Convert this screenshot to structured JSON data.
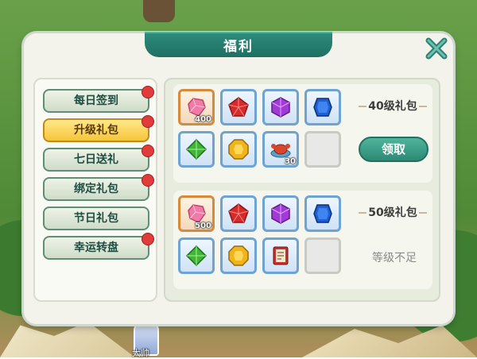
{
  "header": {
    "title": "福利"
  },
  "sidebar": {
    "items": [
      {
        "label": "每日签到",
        "active": false,
        "badge": true
      },
      {
        "label": "升级礼包",
        "active": true,
        "badge": true
      },
      {
        "label": "七日送礼",
        "active": false,
        "badge": true
      },
      {
        "label": "绑定礼包",
        "active": false,
        "badge": true
      },
      {
        "label": "节日礼包",
        "active": false,
        "badge": false
      },
      {
        "label": "幸运转盘",
        "active": false,
        "badge": true
      }
    ]
  },
  "packs": [
    {
      "label": "40级礼包",
      "action": "领取",
      "items": [
        {
          "icon": "pink-gem-icon",
          "qty": "400"
        },
        {
          "icon": "red-gem-icon",
          "qty": ""
        },
        {
          "icon": "purple-gem-icon",
          "qty": ""
        },
        {
          "icon": "blue-gem-icon",
          "qty": ""
        },
        {
          "icon": "green-gem-icon",
          "qty": ""
        },
        {
          "icon": "yellow-gem-icon",
          "qty": ""
        },
        {
          "icon": "crab-food-icon",
          "qty": "30"
        },
        {
          "icon": "",
          "qty": ""
        }
      ]
    },
    {
      "label": "50级礼包",
      "status": "等级不足",
      "items": [
        {
          "icon": "pink-gem-icon",
          "qty": "500"
        },
        {
          "icon": "red-gem-icon",
          "qty": ""
        },
        {
          "icon": "purple-gem-icon",
          "qty": ""
        },
        {
          "icon": "blue-gem-icon",
          "qty": ""
        },
        {
          "icon": "green-gem-icon",
          "qty": ""
        },
        {
          "icon": "yellow-gem-icon",
          "qty": ""
        },
        {
          "icon": "red-book-icon",
          "qty": ""
        },
        {
          "icon": "",
          "qty": ""
        }
      ]
    }
  ],
  "player": {
    "name": "大帅"
  },
  "colors": {
    "accent": "#2d8a74",
    "active_tab": "#f5c53a",
    "badge": "#e23b3b"
  }
}
